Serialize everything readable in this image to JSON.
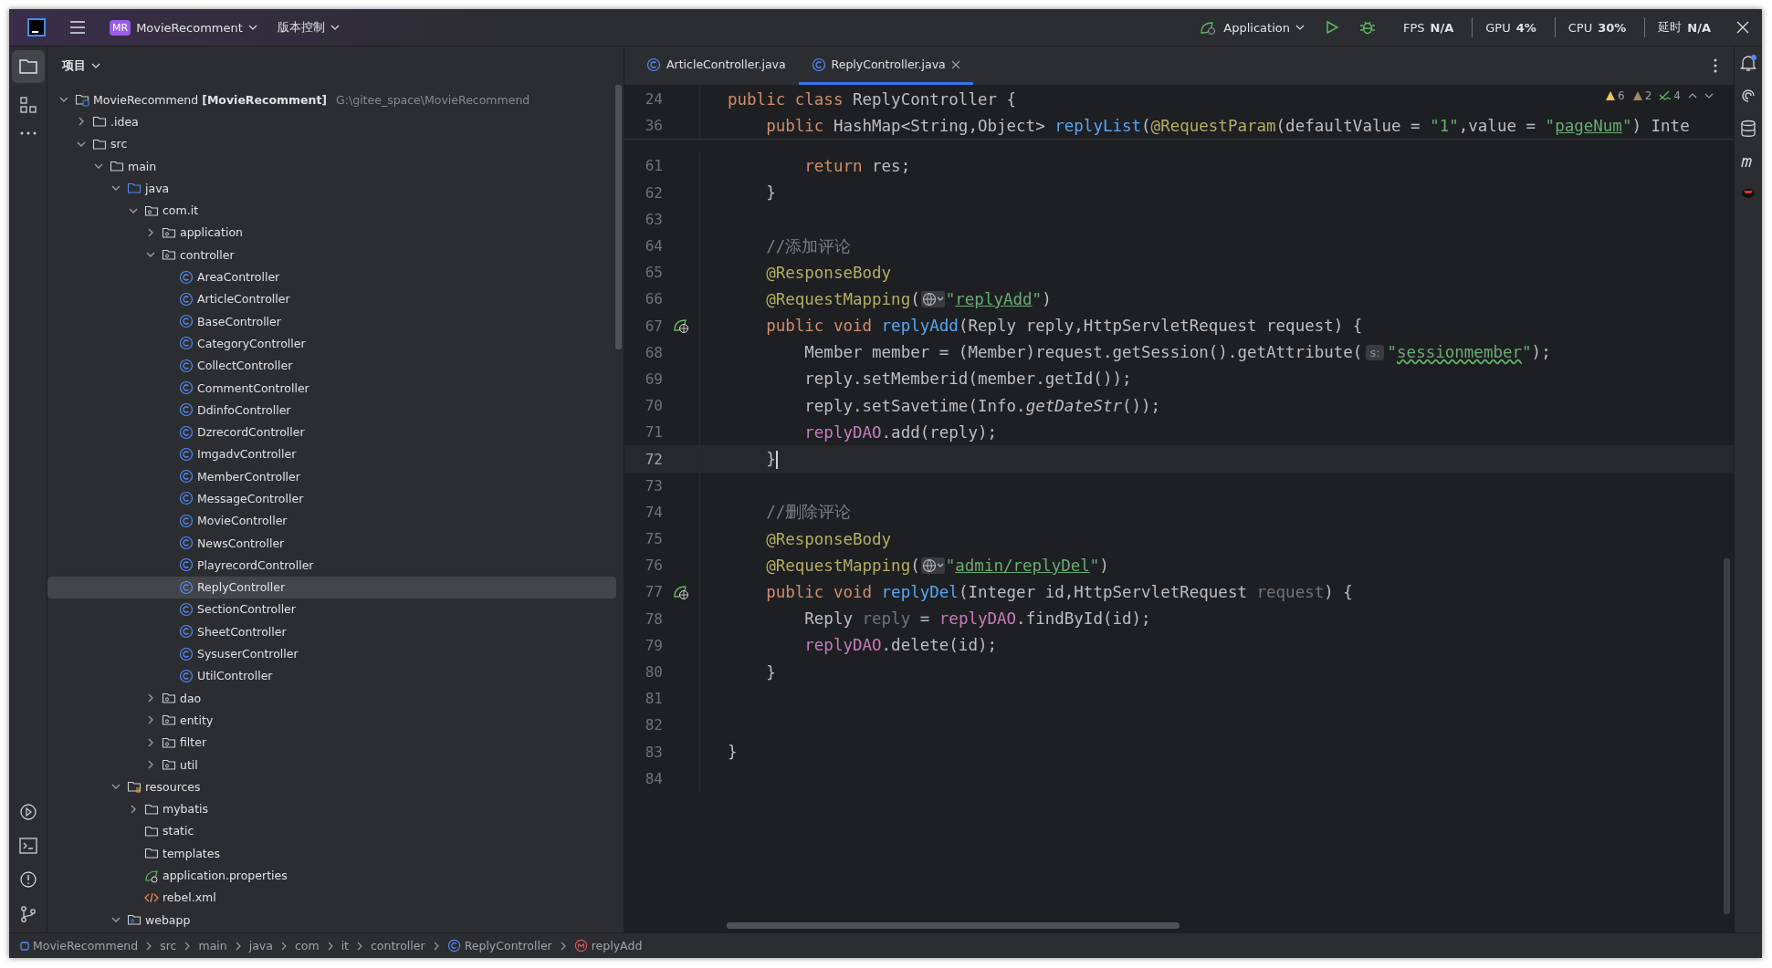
{
  "title_bar": {
    "project_badge": "MR",
    "project": "MovieRecomment",
    "vcs": "版本控制",
    "run_config": "Application",
    "monitor": [
      {
        "label": "FPS",
        "value": "N/A"
      },
      {
        "label": "GPU",
        "value": "4%"
      },
      {
        "label": "CPU",
        "value": "30%"
      },
      {
        "label": "延时",
        "value": "N/A"
      }
    ]
  },
  "project_panel": {
    "title": "项目",
    "tree": [
      {
        "name": "MovieRecommend",
        "qualifier": "[MovieRecomment]",
        "path": "G:\\gitee_space\\MovieRecommend",
        "kind": "module",
        "expanded": true,
        "selected": false,
        "children": [
          {
            "name": ".idea",
            "kind": "folder",
            "expanded": false,
            "selected": false
          },
          {
            "name": "src",
            "kind": "folder",
            "expanded": true,
            "selected": false,
            "children": [
              {
                "name": "main",
                "kind": "folder",
                "expanded": true,
                "selected": false,
                "children": [
                  {
                    "name": "java",
                    "kind": "source",
                    "expanded": true,
                    "selected": false,
                    "children": [
                      {
                        "name": "com.it",
                        "kind": "package",
                        "expanded": true,
                        "selected": false,
                        "children": [
                          {
                            "name": "application",
                            "kind": "package",
                            "expanded": false,
                            "selected": false
                          },
                          {
                            "name": "controller",
                            "kind": "package",
                            "expanded": true,
                            "selected": false,
                            "children": [
                              {
                                "name": "AreaController",
                                "kind": "class",
                                "selected": false
                              },
                              {
                                "name": "ArticleController",
                                "kind": "class",
                                "selected": false
                              },
                              {
                                "name": "BaseController",
                                "kind": "class",
                                "selected": false
                              },
                              {
                                "name": "CategoryController",
                                "kind": "class",
                                "selected": false
                              },
                              {
                                "name": "CollectController",
                                "kind": "class",
                                "selected": false
                              },
                              {
                                "name": "CommentController",
                                "kind": "class",
                                "selected": false
                              },
                              {
                                "name": "DdinfoController",
                                "kind": "class",
                                "selected": false
                              },
                              {
                                "name": "DzrecordController",
                                "kind": "class",
                                "selected": false
                              },
                              {
                                "name": "ImgadvController",
                                "kind": "class",
                                "selected": false
                              },
                              {
                                "name": "MemberController",
                                "kind": "class",
                                "selected": false
                              },
                              {
                                "name": "MessageController",
                                "kind": "class",
                                "selected": false
                              },
                              {
                                "name": "MovieController",
                                "kind": "class",
                                "selected": false
                              },
                              {
                                "name": "NewsController",
                                "kind": "class",
                                "selected": false
                              },
                              {
                                "name": "PlayrecordController",
                                "kind": "class",
                                "selected": false
                              },
                              {
                                "name": "ReplyController",
                                "kind": "class",
                                "selected": true
                              },
                              {
                                "name": "SectionController",
                                "kind": "class",
                                "selected": false
                              },
                              {
                                "name": "SheetController",
                                "kind": "class",
                                "selected": false
                              },
                              {
                                "name": "SysuserController",
                                "kind": "class",
                                "selected": false
                              },
                              {
                                "name": "UtilController",
                                "kind": "class",
                                "selected": false
                              }
                            ]
                          },
                          {
                            "name": "dao",
                            "kind": "package",
                            "expanded": false,
                            "selected": false
                          },
                          {
                            "name": "entity",
                            "kind": "package",
                            "expanded": false,
                            "selected": false
                          },
                          {
                            "name": "filter",
                            "kind": "package",
                            "expanded": false,
                            "selected": false
                          },
                          {
                            "name": "util",
                            "kind": "package",
                            "expanded": false,
                            "selected": false
                          }
                        ]
                      }
                    ]
                  },
                  {
                    "name": "resources",
                    "kind": "resources",
                    "expanded": true,
                    "selected": false,
                    "children": [
                      {
                        "name": "mybatis",
                        "kind": "folder",
                        "expanded": false,
                        "selected": false
                      },
                      {
                        "name": "static",
                        "kind": "folder",
                        "selected": false
                      },
                      {
                        "name": "templates",
                        "kind": "folder",
                        "selected": false
                      },
                      {
                        "name": "application.properties",
                        "kind": "spring",
                        "selected": false
                      },
                      {
                        "name": "rebel.xml",
                        "kind": "xml",
                        "selected": false
                      }
                    ]
                  },
                  {
                    "name": "webapp",
                    "kind": "webroot",
                    "expanded": true,
                    "selected": false
                  }
                ]
              }
            ]
          }
        ]
      }
    ]
  },
  "editor": {
    "tabs": [
      {
        "label": "ArticleController.java",
        "selected": false
      },
      {
        "label": "ReplyController.java",
        "selected": true
      }
    ],
    "inspections": [
      {
        "kind": "warning",
        "count": "6"
      },
      {
        "kind": "weak",
        "count": "2"
      },
      {
        "kind": "typo",
        "count": "4"
      }
    ],
    "sticky_lines": [
      {
        "number": "24",
        "tokens": [
          {
            "kind": "keyword",
            "text": "public class "
          },
          {
            "kind": "plain",
            "text": "ReplyController {"
          }
        ]
      },
      {
        "number": "36",
        "tokens": [
          {
            "kind": "keyword",
            "text": "    public "
          },
          {
            "kind": "plain",
            "text": "HashMap<String,Object> "
          },
          {
            "kind": "method",
            "text": "replyList"
          },
          {
            "kind": "plain",
            "text": "("
          },
          {
            "kind": "annotation",
            "text": "@RequestParam"
          },
          {
            "kind": "plain",
            "text": "(defaultValue = "
          },
          {
            "kind": "string",
            "text": "\"1\""
          },
          {
            "kind": "plain",
            "text": ",value = "
          },
          {
            "kind": "string",
            "text": "\""
          },
          {
            "kind": "link",
            "text": "pageNum"
          },
          {
            "kind": "string",
            "text": "\""
          },
          {
            "kind": "plain",
            "text": ") Inte"
          }
        ]
      }
    ],
    "lines": [
      {
        "number": "61",
        "current": false,
        "gutter_icon": false,
        "tokens": [
          {
            "kind": "keyword",
            "text": "        return "
          },
          {
            "kind": "plain",
            "text": "res;"
          }
        ]
      },
      {
        "number": "62",
        "current": false,
        "gutter_icon": false,
        "tokens": [
          {
            "kind": "plain",
            "text": "    }"
          }
        ]
      },
      {
        "number": "63",
        "current": false,
        "gutter_icon": false
      },
      {
        "number": "64",
        "current": false,
        "gutter_icon": false,
        "tokens": [
          {
            "kind": "comment",
            "text": "    //添加评论"
          }
        ]
      },
      {
        "number": "65",
        "current": false,
        "gutter_icon": false,
        "tokens": [
          {
            "kind": "annotation",
            "text": "    @ResponseBody"
          }
        ]
      },
      {
        "number": "66",
        "current": false,
        "gutter_icon": false,
        "tokens": [
          {
            "kind": "annotation",
            "text": "    @RequestMapping"
          },
          {
            "kind": "plain",
            "text": "("
          },
          {
            "kind": "globe"
          },
          {
            "kind": "string",
            "text": "\""
          },
          {
            "kind": "link",
            "text": "replyAdd"
          },
          {
            "kind": "string",
            "text": "\""
          },
          {
            "kind": "plain",
            "text": ")"
          }
        ]
      },
      {
        "number": "67",
        "current": false,
        "gutter_icon": true,
        "tokens": [
          {
            "kind": "keyword",
            "text": "    public void "
          },
          {
            "kind": "method",
            "text": "replyAdd"
          },
          {
            "kind": "plain",
            "text": "(Reply reply,HttpServletRequest request) {"
          }
        ]
      },
      {
        "number": "68",
        "current": false,
        "gutter_icon": false,
        "tokens": [
          {
            "kind": "plain",
            "text": "        Member member = (Member)request.getSession().getAttribute("
          },
          {
            "kind": "hint",
            "text": "s:"
          },
          {
            "kind": "string",
            "text": "\""
          },
          {
            "kind": "typo",
            "text": "sessionmember"
          },
          {
            "kind": "string",
            "text": "\""
          },
          {
            "kind": "plain",
            "text": ");"
          }
        ]
      },
      {
        "number": "69",
        "current": false,
        "gutter_icon": false,
        "tokens": [
          {
            "kind": "plain",
            "text": "        reply.setMemberid(member.getId());"
          }
        ]
      },
      {
        "number": "70",
        "current": false,
        "gutter_icon": false,
        "tokens": [
          {
            "kind": "plain",
            "text": "        reply.setSavetime(Info."
          },
          {
            "kind": "static",
            "text": "getDateStr"
          },
          {
            "kind": "plain",
            "text": "());"
          }
        ]
      },
      {
        "number": "71",
        "current": false,
        "gutter_icon": false,
        "tokens": [
          {
            "kind": "field",
            "text": "        replyDAO"
          },
          {
            "kind": "plain",
            "text": ".add(reply);"
          }
        ]
      },
      {
        "number": "72",
        "current": true,
        "gutter_icon": false,
        "tokens": [
          {
            "kind": "plain",
            "text": "    }"
          }
        ]
      },
      {
        "number": "73",
        "current": false,
        "gutter_icon": false
      },
      {
        "number": "74",
        "current": false,
        "gutter_icon": false,
        "tokens": [
          {
            "kind": "comment",
            "text": "    //删除评论"
          }
        ]
      },
      {
        "number": "75",
        "current": false,
        "gutter_icon": false,
        "tokens": [
          {
            "kind": "annotation",
            "text": "    @ResponseBody"
          }
        ]
      },
      {
        "number": "76",
        "current": false,
        "gutter_icon": false,
        "tokens": [
          {
            "kind": "annotation",
            "text": "    @RequestMapping"
          },
          {
            "kind": "plain",
            "text": "("
          },
          {
            "kind": "globe"
          },
          {
            "kind": "string",
            "text": "\""
          },
          {
            "kind": "link",
            "text": "admin/replyDel"
          },
          {
            "kind": "string",
            "text": "\""
          },
          {
            "kind": "plain",
            "text": ")"
          }
        ]
      },
      {
        "number": "77",
        "current": false,
        "gutter_icon": true,
        "tokens": [
          {
            "kind": "keyword",
            "text": "    public void "
          },
          {
            "kind": "method",
            "text": "replyDel"
          },
          {
            "kind": "plain",
            "text": "(Integer id,HttpServletRequest "
          },
          {
            "kind": "unused",
            "text": "request"
          },
          {
            "kind": "plain",
            "text": ") {"
          }
        ]
      },
      {
        "number": "78",
        "current": false,
        "gutter_icon": false,
        "tokens": [
          {
            "kind": "plain",
            "text": "        Reply "
          },
          {
            "kind": "unused",
            "text": "reply"
          },
          {
            "kind": "plain",
            "text": " = "
          },
          {
            "kind": "field",
            "text": "replyDAO"
          },
          {
            "kind": "plain",
            "text": ".findById(id);"
          }
        ]
      },
      {
        "number": "79",
        "current": false,
        "gutter_icon": false,
        "tokens": [
          {
            "kind": "field",
            "text": "        replyDAO"
          },
          {
            "kind": "plain",
            "text": ".delete(id);"
          }
        ]
      },
      {
        "number": "80",
        "current": false,
        "gutter_icon": false,
        "tokens": [
          {
            "kind": "plain",
            "text": "    }"
          }
        ]
      },
      {
        "number": "81",
        "current": false,
        "gutter_icon": false
      },
      {
        "number": "82",
        "current": false,
        "gutter_icon": false
      },
      {
        "number": "83",
        "current": false,
        "gutter_icon": false,
        "tokens": [
          {
            "kind": "plain",
            "text": "}"
          }
        ]
      },
      {
        "number": "84",
        "current": false,
        "gutter_icon": false
      }
    ]
  },
  "breadcrumbs": [
    {
      "label": "MovieRecommend",
      "kind": "module"
    },
    {
      "label": "src",
      "kind": "folder"
    },
    {
      "label": "main",
      "kind": "folder"
    },
    {
      "label": "java",
      "kind": "folder"
    },
    {
      "label": "com",
      "kind": "folder"
    },
    {
      "label": "it",
      "kind": "folder"
    },
    {
      "label": "controller",
      "kind": "folder"
    },
    {
      "label": "ReplyController",
      "kind": "class"
    },
    {
      "label": "replyAdd",
      "kind": "method"
    }
  ]
}
